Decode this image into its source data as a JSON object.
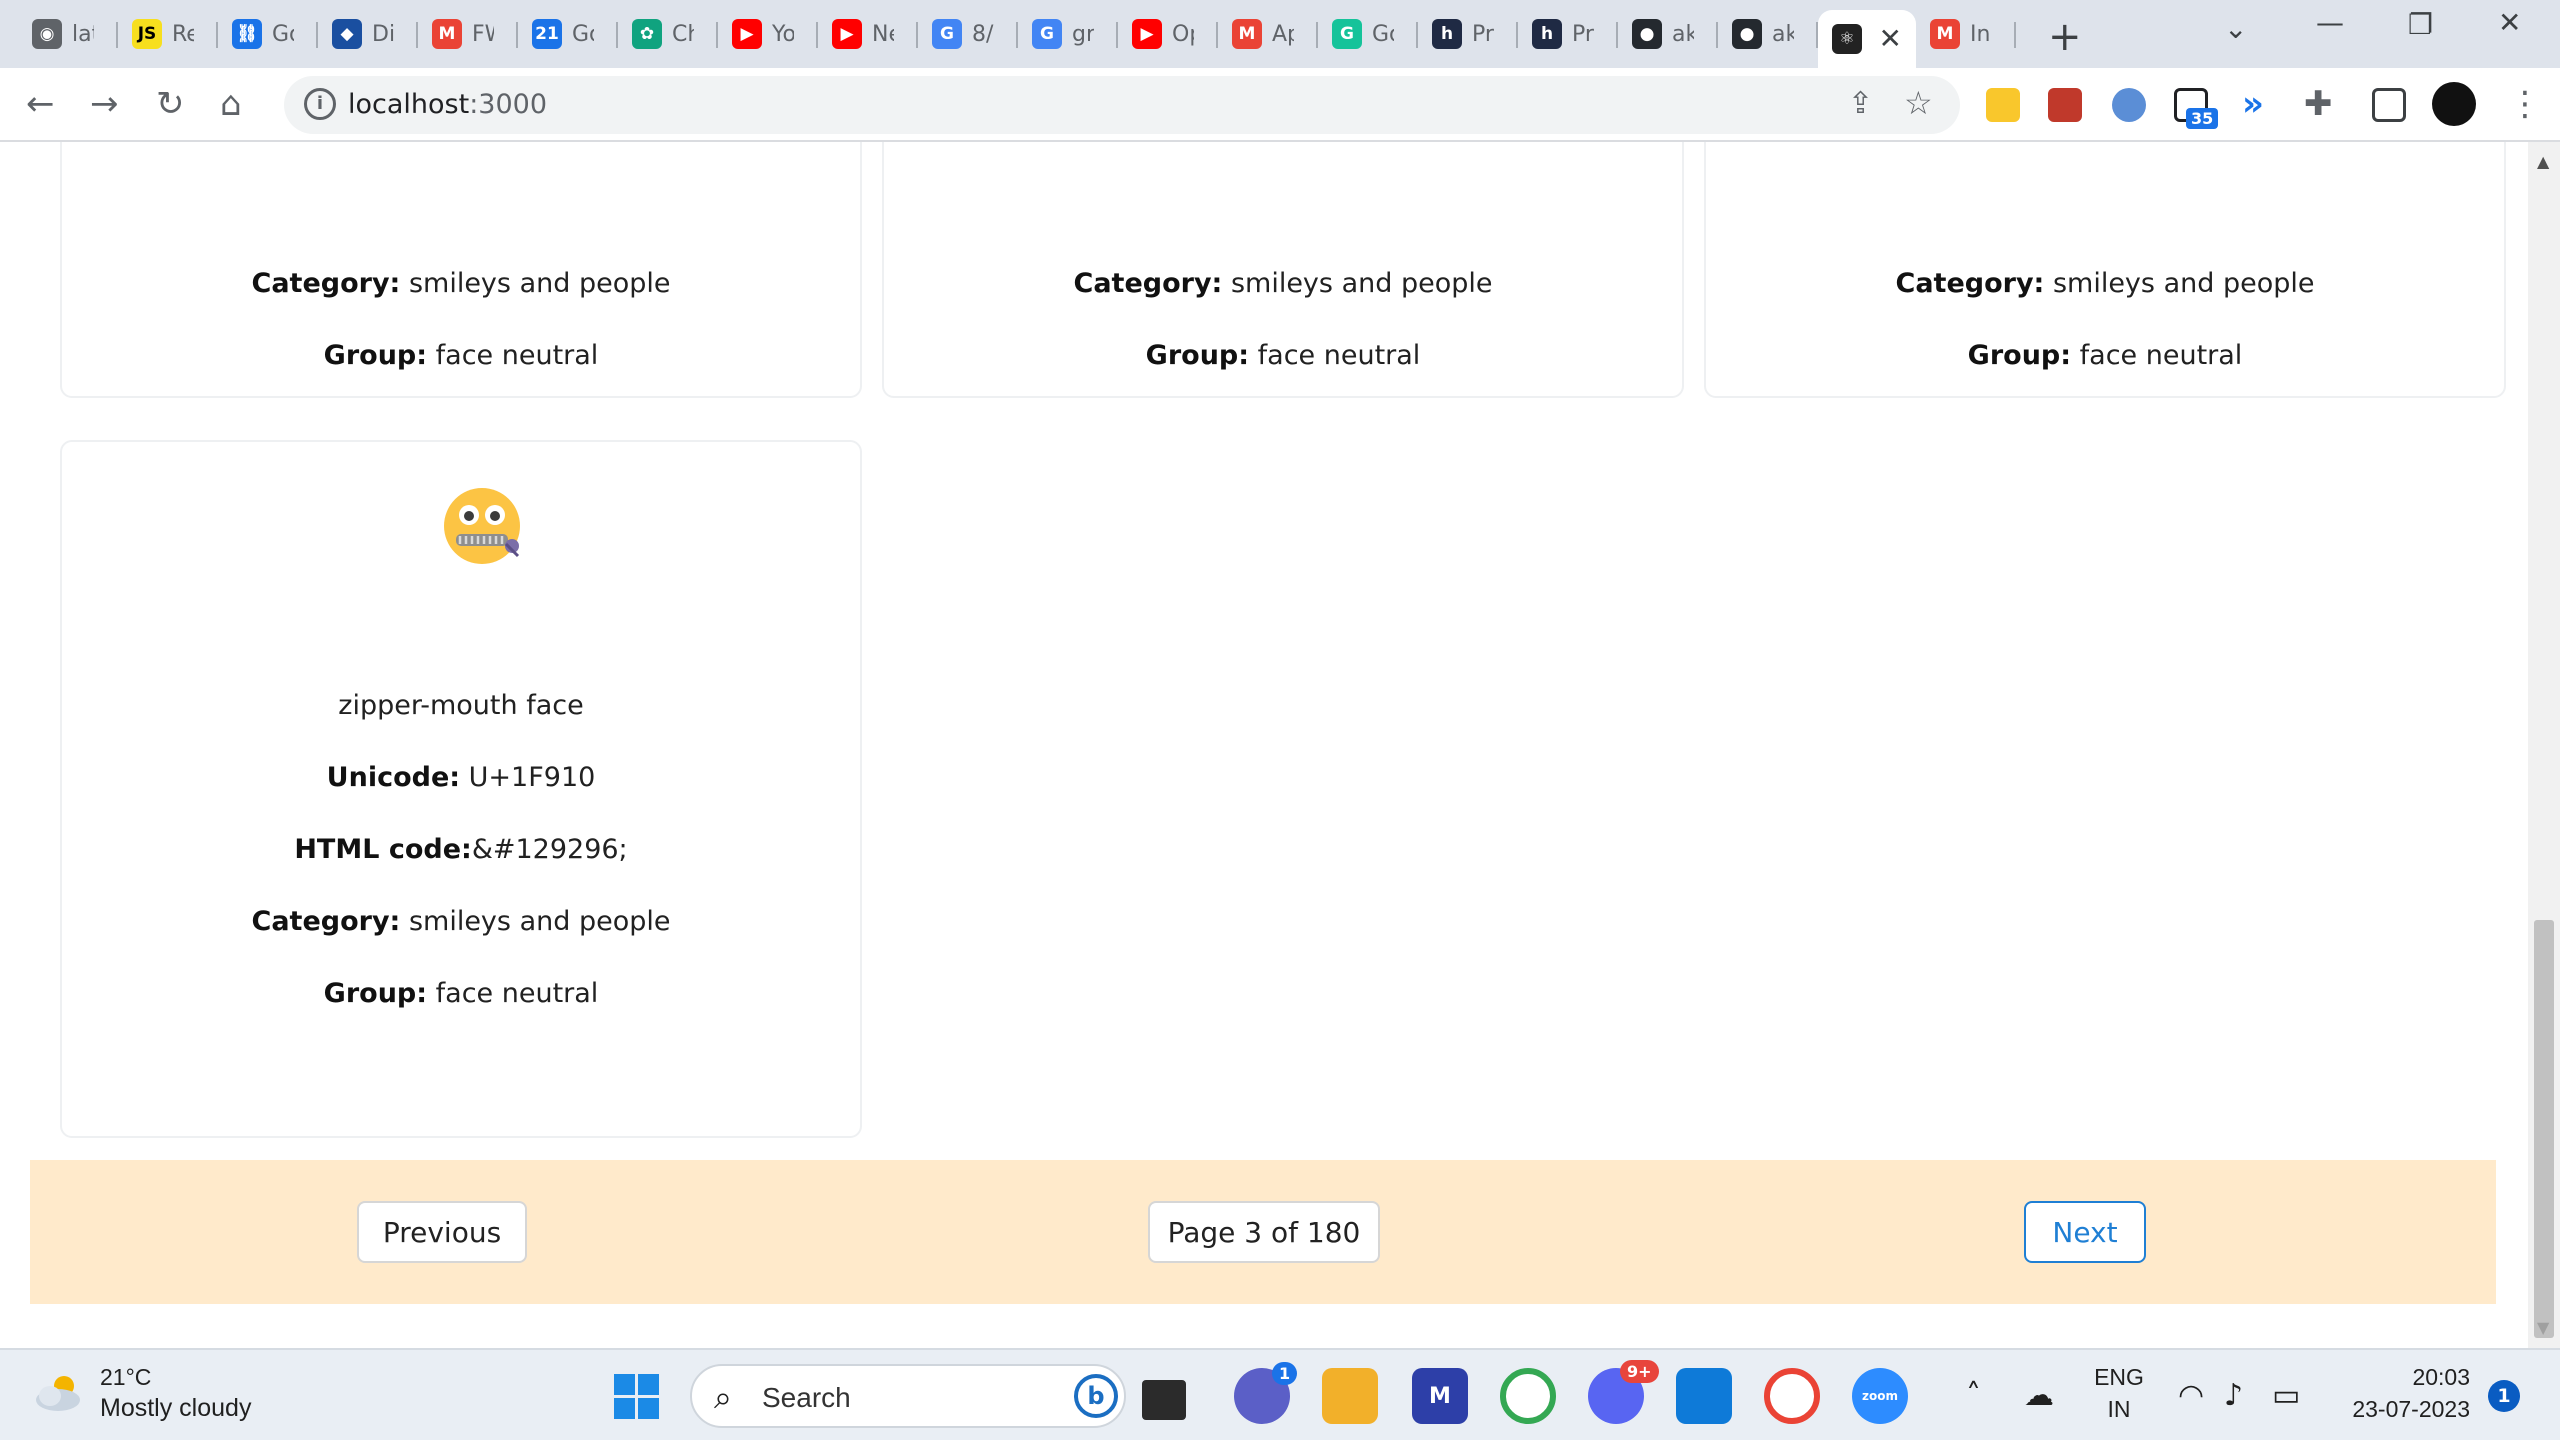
{
  "browser": {
    "tabs": [
      {
        "title": "lat",
        "icon": "globe-icon",
        "color": "#5f6368"
      },
      {
        "title": "Re",
        "icon": "js-icon",
        "color": "#f7df1e"
      },
      {
        "title": "Go",
        "icon": "link-icon",
        "color": "#1a73e8"
      },
      {
        "title": "Di",
        "icon": "diamond-icon",
        "color": "#1a4fa0"
      },
      {
        "title": "FW",
        "icon": "gmail-icon",
        "color": "#ea4335"
      },
      {
        "title": "Go",
        "icon": "calendar-icon",
        "color": "#1a73e8"
      },
      {
        "title": "Ch",
        "icon": "chatgpt-icon",
        "color": "#10a37f"
      },
      {
        "title": "Yo",
        "icon": "youtube-icon",
        "color": "#ff0000"
      },
      {
        "title": "Ne",
        "icon": "youtube-icon",
        "color": "#ff0000"
      },
      {
        "title": "8/",
        "icon": "google-icon",
        "color": "#4285f4"
      },
      {
        "title": "gr",
        "icon": "google-icon",
        "color": "#4285f4"
      },
      {
        "title": "Op",
        "icon": "youtube-icon",
        "color": "#ff0000"
      },
      {
        "title": "Ap",
        "icon": "gmail-icon",
        "color": "#ea4335"
      },
      {
        "title": "Go",
        "icon": "grammarly-icon",
        "color": "#15c39a"
      },
      {
        "title": "Pr",
        "icon": "hashnode-icon",
        "color": "#1f2a44"
      },
      {
        "title": "Pr",
        "icon": "hashnode-icon",
        "color": "#1f2a44"
      },
      {
        "title": "ak",
        "icon": "github-icon",
        "color": "#24292f"
      },
      {
        "title": "ak",
        "icon": "github-icon",
        "color": "#24292f"
      },
      {
        "title": "",
        "icon": "react-icon",
        "color": "#222222",
        "active": true
      },
      {
        "title": "In",
        "icon": "gmail-icon",
        "color": "#ea4335"
      }
    ],
    "url": {
      "host": "localhost",
      "port": ":3000"
    },
    "extension_badge": "35"
  },
  "cards_top_row": [
    {
      "category_label": "Category:",
      "category": "smileys and people",
      "group_label": "Group:",
      "group": "face neutral"
    },
    {
      "category_label": "Category:",
      "category": "smileys and people",
      "group_label": "Group:",
      "group": "face neutral"
    },
    {
      "category_label": "Category:",
      "category": "smileys and people",
      "group_label": "Group:",
      "group": "face neutral"
    }
  ],
  "emoji_card": {
    "name": "zipper-mouth face",
    "unicode_label": "Unicode:",
    "unicode": "U+1F910",
    "html_label": "HTML code:",
    "html_code": "&#129296;",
    "category_label": "Category:",
    "category": "smileys and people",
    "group_label": "Group:",
    "group": "face neutral"
  },
  "pagination": {
    "previous_label": "Previous",
    "page_label": "Page 3 of 180",
    "next_label": "Next",
    "background": "#ffeacb",
    "next_color": "#1f7fd4"
  },
  "taskbar": {
    "weather": {
      "temp": "21°C",
      "desc": "Mostly cloudy"
    },
    "search_label": "Search",
    "teams_badge": "1",
    "discord_badge": "9+",
    "language": {
      "line1": "ENG",
      "line2": "IN"
    },
    "time": "20:03",
    "date": "23-07-2023",
    "notification_count": "1"
  }
}
